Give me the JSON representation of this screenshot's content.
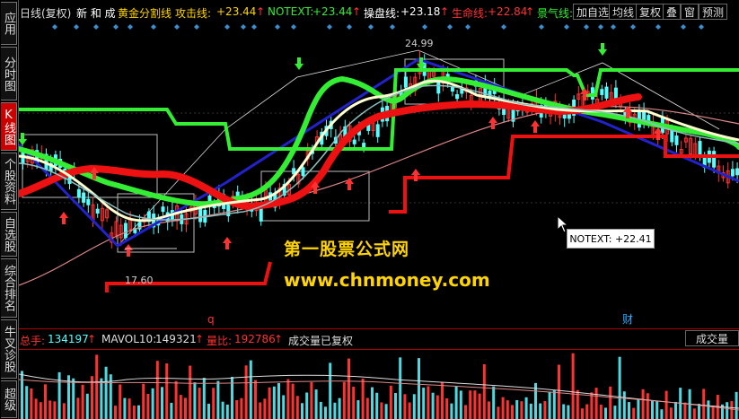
{
  "topbar": {
    "period": "日线(复权)",
    "stock_name": "新 和 成",
    "formula": "黄金分割线",
    "attack_label": "攻击线:",
    "attack_value": "+23.44",
    "notext_label": "NOTEXT:",
    "notext_value": "+23.44",
    "operate_label": "操盘线:",
    "operate_value": "+23.18",
    "life_label": "生命线:",
    "life_value": "+22.84",
    "mood_label": "景气线:",
    "buttons": [
      "加自选",
      "均线",
      "复权",
      "叠",
      "窗",
      "预测"
    ]
  },
  "sidebar": {
    "tabs": [
      "应用",
      "分时图",
      "K线图",
      "个股资料",
      "自选股",
      "综合排名",
      "牛叉诊股",
      "超级"
    ]
  },
  "chart": {
    "high_label": "24.99",
    "low_label": "17.60",
    "tooltip": "NOTEXT: +22.41",
    "watermark_cn": "第一股票公式网",
    "watermark_url": "www.chnmoney.com",
    "marker_q": "q",
    "marker_cai": "财"
  },
  "volume": {
    "total_label": "总手:",
    "total_value": "134197",
    "mavol_label": "MAVOL10:",
    "mavol_value": "149321",
    "ratio_label": "量比:",
    "ratio_value": "192786",
    "status": "成交量已复权",
    "button": "成交量"
  },
  "colors": {
    "up": "#ff3232",
    "down": "#54ffff",
    "green_line": "#33ee33",
    "red_line": "#ee1111",
    "blue_line": "#2222cc",
    "yellow": "#ffd400"
  }
}
